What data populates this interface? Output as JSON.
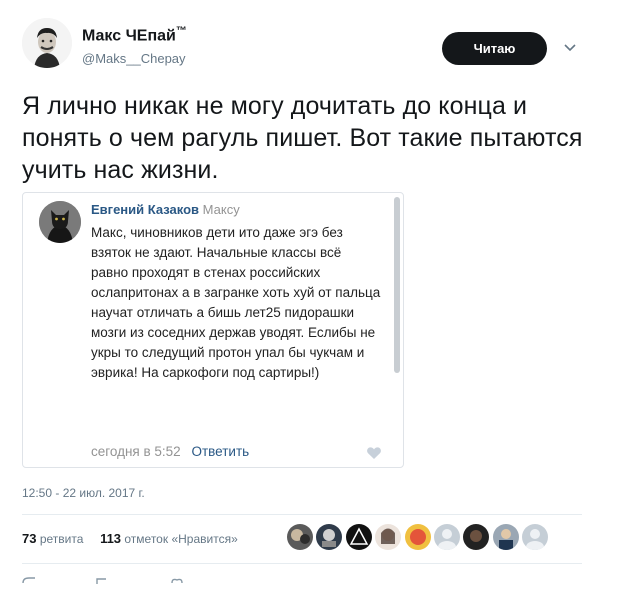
{
  "tweet": {
    "author_name": "Макс ЧЕпай",
    "author_mark": "™",
    "author_handle": "@Maks__Chepay",
    "follow_label": "Читаю",
    "text": "Я лично никак не могу дочитать до конца и понять о чем рагуль пишет. Вот такие пытаются учить нас жизни.",
    "timestamp": "12:50 - 22 июл. 2017 г."
  },
  "embed": {
    "author": "Евгений Казаков",
    "reply_to": "Максу",
    "body": "Макс, чиновников дети ито даже эгэ без взяток не здают. Начальные классы всё равно проходят в стенах российских ослапритонах а в загранке хоть хуй от пальца научат отличать а бишь лет25 пидорашки мозги из соседних держав уводят. Еслибы не укры то следущий протон упал бы чукчам и эврика! На саркофоги под сартиры!)",
    "time": "сегодня в 5:52",
    "reply_label": "Ответить"
  },
  "stats": {
    "retweets_count": "73",
    "retweets_label": "ретвита",
    "likes_count": "113",
    "likes_label": "отметок «Нравится»"
  },
  "colors": {
    "follow_bg": "#14171a",
    "link_blue": "#2a5885",
    "muted": "#657786"
  },
  "icons": [
    "chevron-down-icon",
    "heart-icon",
    "reply-icon",
    "retweet-icon",
    "like-icon"
  ]
}
